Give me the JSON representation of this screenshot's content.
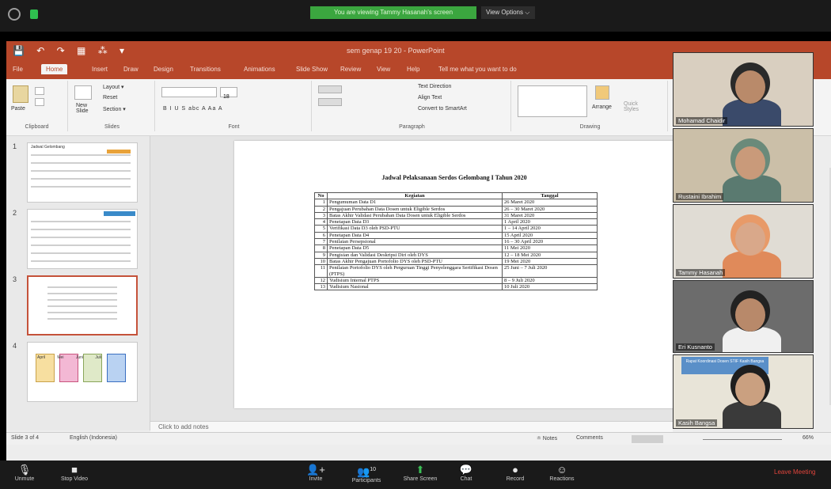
{
  "zoom_top": {
    "banner": "You are viewing Tammy Hasanah's screen",
    "view_options": "View Options ⌵"
  },
  "powerpoint": {
    "title": "sem genap 19 20  -  PowerPoint",
    "qat": "💾 ↶ ↷ ▦ ⁂ ▾",
    "tabs": [
      "File",
      "Home",
      "Insert",
      "Draw",
      "Design",
      "Transitions",
      "Animations",
      "Slide Show",
      "Review",
      "View",
      "Help",
      "Tell me what you want to do"
    ],
    "ribbon": {
      "clipboard": {
        "label": "Clipboard",
        "paste": "Paste"
      },
      "slides": {
        "label": "Slides",
        "new_slide": "New\nSlide",
        "layout": "Layout ▾",
        "reset": "Reset",
        "section": "Section ▾"
      },
      "font": {
        "label": "Font",
        "size": "18",
        "row2": "B  I  U  S  abc  A  Aa  A"
      },
      "paragraph": {
        "label": "Paragraph",
        "text_direction": "Text Direction",
        "align_text": "Align Text",
        "smartart": "Convert to SmartArt"
      },
      "drawing": {
        "label": "Drawing",
        "arrange": "Arrange",
        "quick_styles": "Quick\nStyles"
      }
    },
    "thumbnails": [
      {
        "num": "1",
        "title": "Jadwal Gelombang",
        "selected": false
      },
      {
        "num": "2",
        "title": "",
        "selected": false
      },
      {
        "num": "3",
        "title": "",
        "selected": true
      },
      {
        "num": "4",
        "title": "April  Mei  Juni  Juli",
        "selected": false
      }
    ],
    "slide": {
      "title": "Jadwal Pelaksanaan Serdos Gelombang I Tahun 2020",
      "headers": [
        "No",
        "Kegiatan",
        "Tanggal"
      ],
      "rows": [
        [
          "1",
          "Pengumuman Data D1",
          "26 Maret 2020"
        ],
        [
          "2",
          "Pengajuan Perubahan Data Dosen untuk Eligible Serdos",
          "26 – 30 Maret 2020"
        ],
        [
          "3",
          "Batas Akhir Validasi Perubahan Data Dosen untuk Eligible Serdos",
          "31 Maret 2020"
        ],
        [
          "4",
          "Penetapan Data D3",
          "1 April 2020"
        ],
        [
          "5",
          "Verifikasi Data D3 oleh PSD-PTU",
          "1 – 14 April 2020"
        ],
        [
          "6",
          "Penetapan Data D4",
          "15 April 2020"
        ],
        [
          "7",
          "Penilaian Persepsional",
          "16 – 30 April 2020"
        ],
        [
          "8",
          "Penetapan Data D5",
          "11 Mei 2020"
        ],
        [
          "9",
          "Pengisian dan Validasi Deskripsi Diri oleh DYS",
          "12 – 18 Mei 2020"
        ],
        [
          "10",
          "Batas Akhir Pengajuan Portofolio DYS oleh PSD-PTU",
          "19 Mei 2020"
        ],
        [
          "11",
          "Penilaian Portofolio DYS oleh Perguruan Tinggi Penyelenggara Sertifikasi Dosen (PTPS)",
          "25 Juni – 7 Juli 2020"
        ],
        [
          "12",
          "Yudisium Internal PTPS",
          "8 – 9 Juli 2020"
        ],
        [
          "13",
          "Yudisium Nasional",
          "10 Juli 2020"
        ]
      ]
    },
    "notes_placeholder": "Click to add notes",
    "status": {
      "slide_count": "Slide 3 of 4",
      "language": "English (Indonesia)",
      "notes": "≐ Notes",
      "comments": "Comments",
      "zoom": "66%"
    }
  },
  "participants": [
    {
      "name": "Mohamad Chaidir",
      "bg": "#d9cfc0",
      "skin": "#b98a6a",
      "hair": "#2a2a2a",
      "shirt": "#3a4a6a"
    },
    {
      "name": "Rustaini Ibrahim",
      "bg": "#cbbfa8",
      "skin": "#c99a7a",
      "hair": "#6a8a7a",
      "shirt": "#5a7a70"
    },
    {
      "name": "Tammy Hasanah",
      "bg": "#e0dcd4",
      "skin": "#d9a88a",
      "hair": "#e89a68",
      "shirt": "#e08a5a"
    },
    {
      "name": "Eri Kusnanto",
      "bg": "#6c6c6c",
      "skin": "#b8896a",
      "hair": "#222",
      "shirt": "#f0f0f0"
    },
    {
      "name": "Kasih Bangsa",
      "bg": "#e8e4d8",
      "skin": "#caa080",
      "hair": "#1e1e1e",
      "shirt": "#3a3a3a",
      "banner": "Rapat Koordinasi Dosen STIF Kasih Bangsa"
    }
  ],
  "zoom_bottom": {
    "items": [
      {
        "glyph": "🎙",
        "label": "Unmute"
      },
      {
        "glyph": "■",
        "label": "Stop Video"
      },
      {
        "glyph": "👤+",
        "label": "Invite"
      },
      {
        "glyph": "👥",
        "label": "Participants",
        "count": "10"
      },
      {
        "glyph": "⬆",
        "label": "Share Screen"
      },
      {
        "glyph": "💬",
        "label": "Chat"
      },
      {
        "glyph": "●",
        "label": "Record"
      },
      {
        "glyph": "☺",
        "label": "Reactions"
      }
    ],
    "leave": "Leave Meeting"
  },
  "colors": {
    "ppt_red": "#b7472a",
    "zoom_green": "#3ba63f",
    "leave_red": "#e0443b"
  }
}
